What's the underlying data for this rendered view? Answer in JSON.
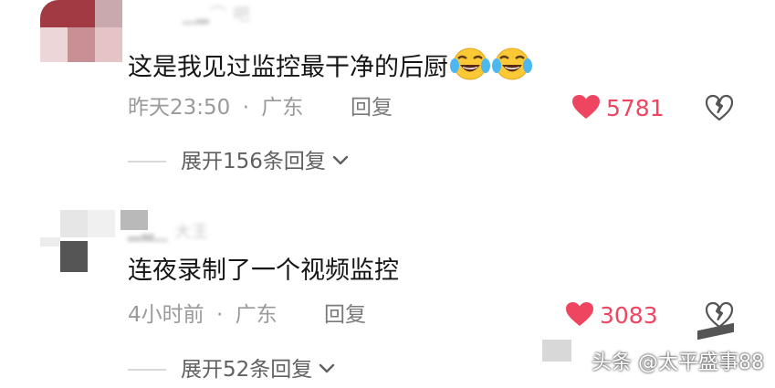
{
  "comments": [
    {
      "text": "这是我见过监控最干净的后厨",
      "emojis": [
        "crying-laughing-emoji",
        "crying-laughing-emoji"
      ],
      "time": "昨天23:50",
      "separator": "·",
      "location": "广东",
      "reply_label": "回复",
      "likes": "5781",
      "expand_label": "展开156条回复"
    },
    {
      "text": "连夜录制了一个视频监控",
      "time": "4小时前",
      "separator": "·",
      "location": "广东",
      "reply_label": "回复",
      "likes": "3083",
      "expand_label": "展开52条回复"
    }
  ],
  "watermark": "头条 @太平盛事88",
  "colors": {
    "like": "#ee4660",
    "meta": "#9a9a9a",
    "text": "#151515"
  }
}
